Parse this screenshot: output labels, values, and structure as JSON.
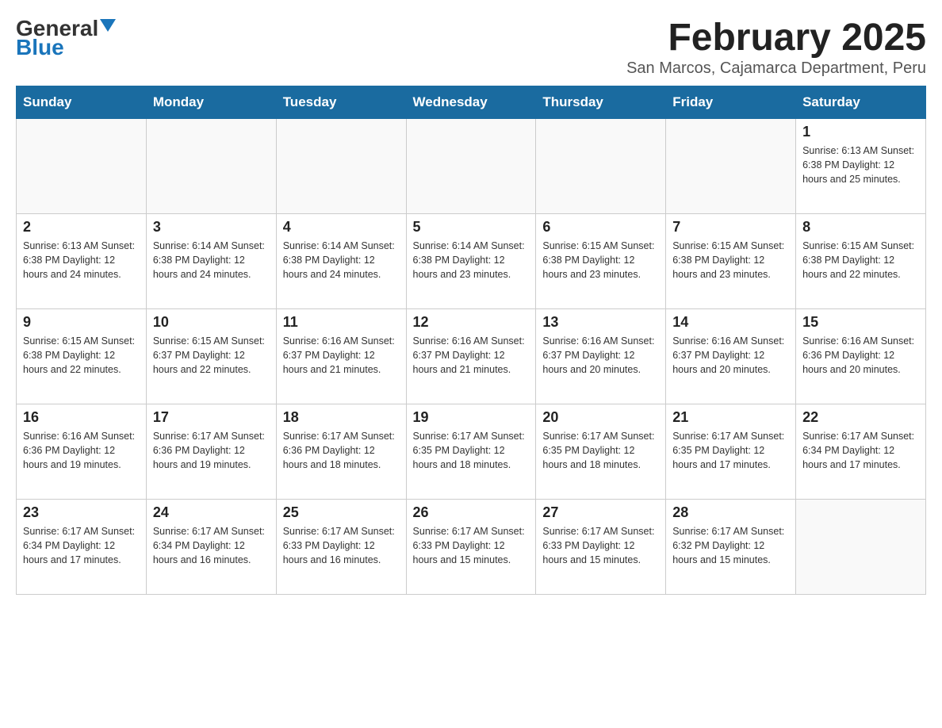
{
  "header": {
    "logo_general": "General",
    "logo_blue": "Blue",
    "title": "February 2025",
    "subtitle": "San Marcos, Cajamarca Department, Peru"
  },
  "days_of_week": [
    "Sunday",
    "Monday",
    "Tuesday",
    "Wednesday",
    "Thursday",
    "Friday",
    "Saturday"
  ],
  "weeks": [
    [
      {
        "day": "",
        "info": ""
      },
      {
        "day": "",
        "info": ""
      },
      {
        "day": "",
        "info": ""
      },
      {
        "day": "",
        "info": ""
      },
      {
        "day": "",
        "info": ""
      },
      {
        "day": "",
        "info": ""
      },
      {
        "day": "1",
        "info": "Sunrise: 6:13 AM\nSunset: 6:38 PM\nDaylight: 12 hours and 25 minutes."
      }
    ],
    [
      {
        "day": "2",
        "info": "Sunrise: 6:13 AM\nSunset: 6:38 PM\nDaylight: 12 hours and 24 minutes."
      },
      {
        "day": "3",
        "info": "Sunrise: 6:14 AM\nSunset: 6:38 PM\nDaylight: 12 hours and 24 minutes."
      },
      {
        "day": "4",
        "info": "Sunrise: 6:14 AM\nSunset: 6:38 PM\nDaylight: 12 hours and 24 minutes."
      },
      {
        "day": "5",
        "info": "Sunrise: 6:14 AM\nSunset: 6:38 PM\nDaylight: 12 hours and 23 minutes."
      },
      {
        "day": "6",
        "info": "Sunrise: 6:15 AM\nSunset: 6:38 PM\nDaylight: 12 hours and 23 minutes."
      },
      {
        "day": "7",
        "info": "Sunrise: 6:15 AM\nSunset: 6:38 PM\nDaylight: 12 hours and 23 minutes."
      },
      {
        "day": "8",
        "info": "Sunrise: 6:15 AM\nSunset: 6:38 PM\nDaylight: 12 hours and 22 minutes."
      }
    ],
    [
      {
        "day": "9",
        "info": "Sunrise: 6:15 AM\nSunset: 6:38 PM\nDaylight: 12 hours and 22 minutes."
      },
      {
        "day": "10",
        "info": "Sunrise: 6:15 AM\nSunset: 6:37 PM\nDaylight: 12 hours and 22 minutes."
      },
      {
        "day": "11",
        "info": "Sunrise: 6:16 AM\nSunset: 6:37 PM\nDaylight: 12 hours and 21 minutes."
      },
      {
        "day": "12",
        "info": "Sunrise: 6:16 AM\nSunset: 6:37 PM\nDaylight: 12 hours and 21 minutes."
      },
      {
        "day": "13",
        "info": "Sunrise: 6:16 AM\nSunset: 6:37 PM\nDaylight: 12 hours and 20 minutes."
      },
      {
        "day": "14",
        "info": "Sunrise: 6:16 AM\nSunset: 6:37 PM\nDaylight: 12 hours and 20 minutes."
      },
      {
        "day": "15",
        "info": "Sunrise: 6:16 AM\nSunset: 6:36 PM\nDaylight: 12 hours and 20 minutes."
      }
    ],
    [
      {
        "day": "16",
        "info": "Sunrise: 6:16 AM\nSunset: 6:36 PM\nDaylight: 12 hours and 19 minutes."
      },
      {
        "day": "17",
        "info": "Sunrise: 6:17 AM\nSunset: 6:36 PM\nDaylight: 12 hours and 19 minutes."
      },
      {
        "day": "18",
        "info": "Sunrise: 6:17 AM\nSunset: 6:36 PM\nDaylight: 12 hours and 18 minutes."
      },
      {
        "day": "19",
        "info": "Sunrise: 6:17 AM\nSunset: 6:35 PM\nDaylight: 12 hours and 18 minutes."
      },
      {
        "day": "20",
        "info": "Sunrise: 6:17 AM\nSunset: 6:35 PM\nDaylight: 12 hours and 18 minutes."
      },
      {
        "day": "21",
        "info": "Sunrise: 6:17 AM\nSunset: 6:35 PM\nDaylight: 12 hours and 17 minutes."
      },
      {
        "day": "22",
        "info": "Sunrise: 6:17 AM\nSunset: 6:34 PM\nDaylight: 12 hours and 17 minutes."
      }
    ],
    [
      {
        "day": "23",
        "info": "Sunrise: 6:17 AM\nSunset: 6:34 PM\nDaylight: 12 hours and 17 minutes."
      },
      {
        "day": "24",
        "info": "Sunrise: 6:17 AM\nSunset: 6:34 PM\nDaylight: 12 hours and 16 minutes."
      },
      {
        "day": "25",
        "info": "Sunrise: 6:17 AM\nSunset: 6:33 PM\nDaylight: 12 hours and 16 minutes."
      },
      {
        "day": "26",
        "info": "Sunrise: 6:17 AM\nSunset: 6:33 PM\nDaylight: 12 hours and 15 minutes."
      },
      {
        "day": "27",
        "info": "Sunrise: 6:17 AM\nSunset: 6:33 PM\nDaylight: 12 hours and 15 minutes."
      },
      {
        "day": "28",
        "info": "Sunrise: 6:17 AM\nSunset: 6:32 PM\nDaylight: 12 hours and 15 minutes."
      },
      {
        "day": "",
        "info": ""
      }
    ]
  ]
}
